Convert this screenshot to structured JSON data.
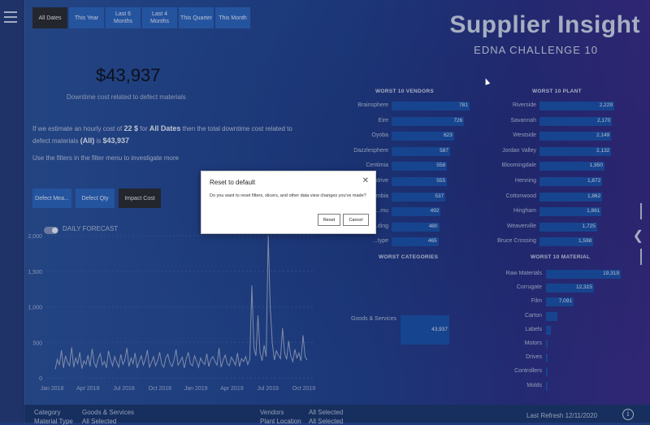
{
  "report": {
    "title": "Supplier Insight",
    "subtitle": "EDNA CHALLENGE 10"
  },
  "date_buttons": [
    "All Dates",
    "This Year",
    "Last 6 Months",
    "Last 4 Months",
    "This Quarter",
    "This Month"
  ],
  "kpi": {
    "value": "$43,937",
    "caption": "Downtime cost related to defect materials"
  },
  "summary": {
    "part1": "If we estimate an hourly cost of",
    "rate": "22 $",
    "part2": "for",
    "period": "All Dates",
    "part3": "then the total downtime cost related to defect materials",
    "category": "(All)",
    "part4": "is",
    "total": "$43,937",
    "hint": "Use the filters in the filter menu to investigate more"
  },
  "filter_buttons": [
    "Defect Mea...",
    "Defect Qty",
    "Impact Cost"
  ],
  "forecast": {
    "label": "DAILY FORECAST"
  },
  "worst_vendors": {
    "title": "WORST 10 VENDORS",
    "items": [
      {
        "label": "Brainsphere",
        "value": "781",
        "fraction": 1.0
      },
      {
        "label": "Eire",
        "value": "726",
        "fraction": 0.93
      },
      {
        "label": "Oyoba",
        "value": "623",
        "fraction": 0.8
      },
      {
        "label": "Dazzlesphere",
        "value": "587",
        "fraction": 0.75
      },
      {
        "label": "Centimia",
        "value": "558",
        "fraction": 0.71
      },
      {
        "label": "Browsedrive",
        "value": "555",
        "fraction": 0.71
      },
      {
        "label": "...mbia",
        "value": "537",
        "fraction": 0.69
      },
      {
        "label": "...mu",
        "value": "492",
        "fraction": 0.63
      },
      {
        "label": "...ding",
        "value": "480",
        "fraction": 0.61
      },
      {
        "label": "...type",
        "value": "465",
        "fraction": 0.6
      }
    ]
  },
  "worst_plant": {
    "title": "WORST 10 PLANT",
    "items": [
      {
        "label": "Riverside",
        "value": "2,229",
        "fraction": 1.0
      },
      {
        "label": "Savannah",
        "value": "2,170",
        "fraction": 0.97
      },
      {
        "label": "Westside",
        "value": "2,149",
        "fraction": 0.96
      },
      {
        "label": "Jordan Valley",
        "value": "2,132",
        "fraction": 0.96
      },
      {
        "label": "Bloomingdale",
        "value": "1,950",
        "fraction": 0.87
      },
      {
        "label": "Henning",
        "value": "1,872",
        "fraction": 0.84
      },
      {
        "label": "Cottonwood",
        "value": "1,862",
        "fraction": 0.84
      },
      {
        "label": "Hingham",
        "value": "1,861",
        "fraction": 0.83
      },
      {
        "label": "Weaverville",
        "value": "1,725",
        "fraction": 0.77
      },
      {
        "label": "Bruce Crossing",
        "value": "1,598",
        "fraction": 0.72
      }
    ]
  },
  "worst_categories": {
    "title": "WORST CATEGORIES",
    "items": [
      {
        "label": "Goods & Services",
        "value": "43,937",
        "fraction": 1.0
      }
    ]
  },
  "worst_material": {
    "title": "WORST 10 MATERIAL",
    "items": [
      {
        "label": "Raw Materials",
        "value": "19,319",
        "fraction": 1.0
      },
      {
        "label": "Corrugate",
        "value": "12,315",
        "fraction": 0.64
      },
      {
        "label": "Film",
        "value": "7,091",
        "fraction": 0.37
      },
      {
        "label": "Carton",
        "value": "",
        "fraction": 0.15
      },
      {
        "label": "Labels",
        "value": "",
        "fraction": 0.06
      },
      {
        "label": "Motors",
        "value": "",
        "fraction": 0.02
      },
      {
        "label": "Drives",
        "value": "",
        "fraction": 0.02
      },
      {
        "label": "Controllers",
        "value": "",
        "fraction": 0.015
      },
      {
        "label": "Molds",
        "value": "",
        "fraction": 0.01
      }
    ]
  },
  "bottom": {
    "category_label": "Category",
    "category_value": "Goods & Services",
    "material_type_label": "Material Type",
    "material_type_value": "All Selected",
    "vendors_label": "Vendors",
    "vendors_value": "All Selected",
    "plant_location_label": "Plant Location",
    "plant_location_value": "All Selected",
    "last_refresh": "Last Refresh  12/11/2020"
  },
  "dialog": {
    "title": "Reset to default",
    "message": "Do you want to reset filters, slicers, and other data view changes you've made?",
    "reset_label": "Reset",
    "cancel_label": "Cancel"
  },
  "colors": {
    "bar": "#1a4fa0",
    "button": "#2b62b5",
    "active_button": "#2a2a2a",
    "line": "#9aa7c2"
  },
  "chart_data": {
    "type": "line",
    "title": "",
    "xlabel": "",
    "ylabel": "",
    "x_ticks": [
      "Jan 2018",
      "Apr 2018",
      "Jul 2018",
      "Oct 2018",
      "Jan 2019",
      "Apr 2019",
      "Jul 2019",
      "Oct 2019"
    ],
    "y_ticks": [
      "0",
      "500",
      "1,000",
      "1,500",
      "2,000"
    ],
    "ylim": [
      0,
      2000
    ],
    "series": [
      {
        "name": "",
        "values": [
          120,
          260,
          180,
          390,
          140,
          310,
          220,
          170,
          430,
          150,
          280,
          200,
          360,
          130,
          240,
          190,
          320,
          160,
          410,
          210,
          150,
          270,
          340,
          180,
          230,
          140,
          380,
          260,
          170,
          300,
          220,
          150,
          330,
          190,
          250,
          420,
          160,
          280,
          200,
          350,
          140,
          230,
          310,
          180,
          260,
          390,
          150,
          220,
          300,
          170,
          240,
          360,
          190,
          150,
          280,
          330,
          210,
          160,
          250,
          400,
          180,
          230,
          290,
          140,
          270,
          360,
          200,
          170,
          310,
          240,
          150,
          280,
          220,
          190,
          340,
          160,
          260,
          300,
          230,
          180,
          420,
          150,
          250,
          320,
          200,
          170,
          290,
          240,
          180,
          350,
          160,
          270,
          230,
          300,
          190,
          260,
          1300,
          420,
          310,
          880,
          360,
          240,
          460,
          300,
          2000,
          1000,
          480,
          250,
          380,
          320,
          270,
          700,
          350,
          260,
          520,
          310,
          230,
          400,
          280,
          350,
          240,
          600,
          300,
          250
        ]
      }
    ]
  }
}
